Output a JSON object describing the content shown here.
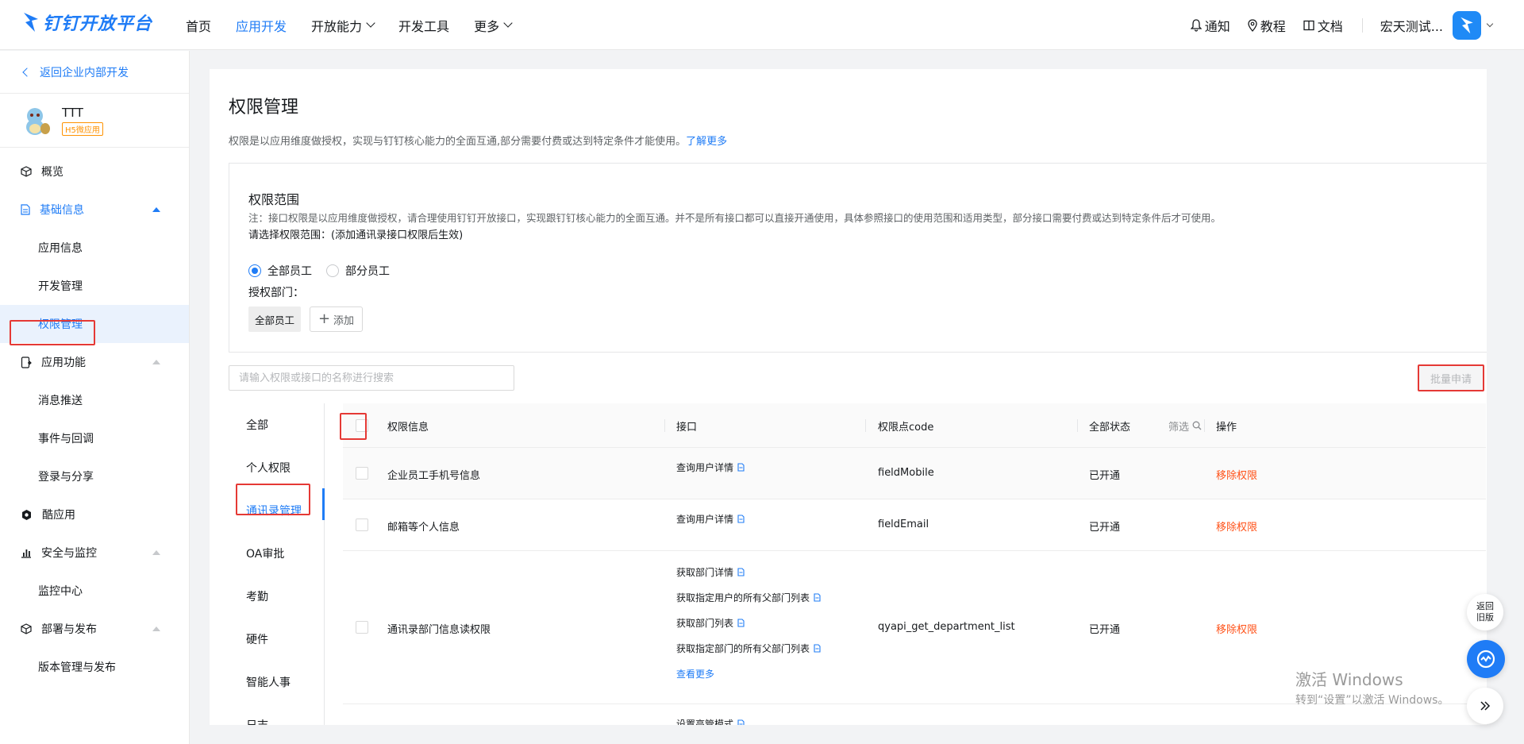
{
  "header": {
    "logo_text": "钉钉开放平台",
    "nav": [
      {
        "label": "首页",
        "has_dropdown": false,
        "active": false
      },
      {
        "label": "应用开发",
        "has_dropdown": false,
        "active": true
      },
      {
        "label": "开放能力",
        "has_dropdown": true,
        "active": false
      },
      {
        "label": "开发工具",
        "has_dropdown": false,
        "active": false
      },
      {
        "label": "更多",
        "has_dropdown": true,
        "active": false
      }
    ],
    "notify": "通知",
    "tutorial": "教程",
    "docs": "文档",
    "user_name": "宏天测试..."
  },
  "sidebar": {
    "back_label": "返回企业内部开发",
    "app": {
      "name": "TTT",
      "tag": "H5微应用"
    },
    "menu": {
      "overview": "概览",
      "basic": {
        "label": "基础信息",
        "items": [
          "应用信息",
          "开发管理",
          "权限管理"
        ]
      },
      "features": {
        "label": "应用功能",
        "items": [
          "消息推送",
          "事件与回调",
          "登录与分享"
        ]
      },
      "cool_app": "酷应用",
      "security": {
        "label": "安全与监控",
        "items": [
          "监控中心"
        ]
      },
      "deploy": {
        "label": "部署与发布",
        "items": [
          "版本管理与发布"
        ]
      }
    }
  },
  "main": {
    "title": "权限管理",
    "desc": "权限是以应用维度做授权，实现与钉钉核心能力的全面互通,部分需要付费或达到特定条件才能使用。",
    "learn_more": "了解更多",
    "scope": {
      "title": "权限范围",
      "note": "注：接口权限是以应用维度做授权，请合理使用钉钉开放接口，实现跟钉钉核心能力的全面互通。并不是所有接口都可以直接开通使用，具体参照接口的使用范围和适用类型，部分接口需要付费或达到特定条件后才可使用。",
      "select_label": "请选择权限范围：(添加通讯录接口权限后生效)",
      "radio_all": "全部员工",
      "radio_part": "部分员工",
      "auth_dept_label": "授权部门：",
      "dept_tag": "全部员工",
      "add_label": "添加"
    },
    "search_placeholder": "请输入权限或接口的名称进行搜索",
    "batch_apply": "批量申请",
    "categories": [
      "全部",
      "个人权限",
      "通讯录管理",
      "OA审批",
      "考勤",
      "硬件",
      "智能人事",
      "日志"
    ],
    "table": {
      "headers": {
        "info": "权限信息",
        "api": "接口",
        "code": "权限点code",
        "status": "全部状态",
        "filter": "筛选",
        "action": "操作"
      },
      "rows": [
        {
          "name": "企业员工手机号信息",
          "apis": [
            "查询用户详情"
          ],
          "code": "fieldMobile",
          "status": "已开通",
          "action": "移除权限"
        },
        {
          "name": "邮箱等个人信息",
          "apis": [
            "查询用户详情"
          ],
          "code": "fieldEmail",
          "status": "已开通",
          "action": "移除权限"
        },
        {
          "name": "通讯录部门信息读权限",
          "apis": [
            "获取部门详情",
            "获取指定用户的所有父部门列表",
            "获取部门列表",
            "获取指定部门的所有父部门列表"
          ],
          "more": "查看更多",
          "code": "qyapi_get_department_list",
          "status": "已开通",
          "action": "移除权限"
        }
      ],
      "partial_api": "设置高管模式"
    }
  },
  "floating": {
    "old_version": "返回旧版"
  },
  "watermark": {
    "line1": "激活 Windows",
    "line2": "转到“设置”以激活 Windows。"
  }
}
